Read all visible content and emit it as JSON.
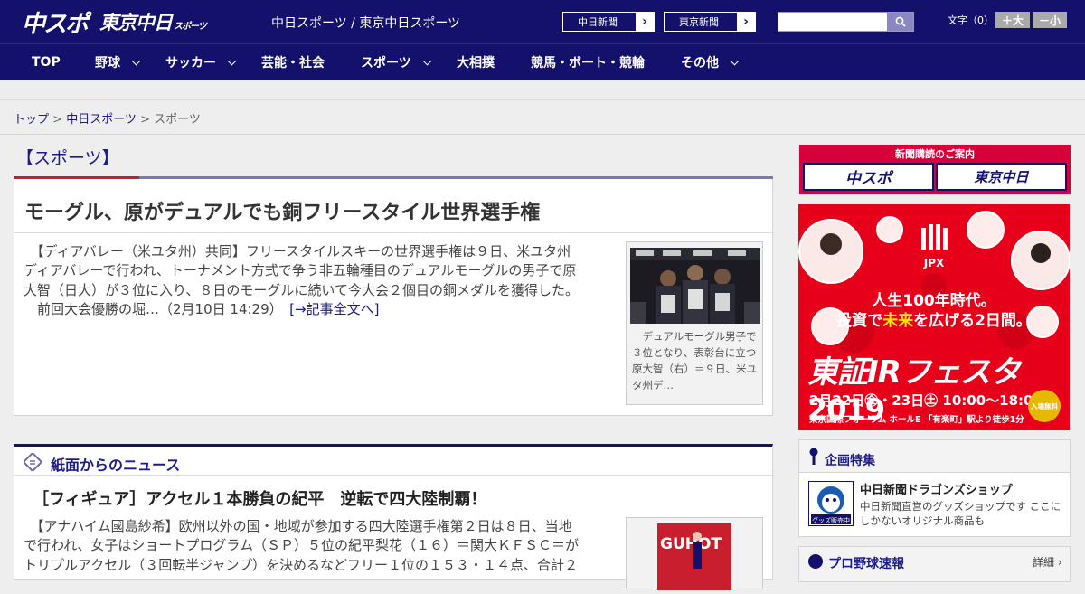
{
  "header": {
    "logo_main": "中スポ",
    "logo_tokyo": "東京中日",
    "logo_tokyo_sub": "スポーツ",
    "site_links": "中日スポーツ / 東京中日スポーツ",
    "chunichi_btn": "中日新聞",
    "tokyo_btn": "東京新聞",
    "search_placeholder": "",
    "font_size_label": "文字（0）",
    "font_up": "＋大",
    "font_down": "－小"
  },
  "nav": {
    "items": [
      {
        "label": "TOP"
      },
      {
        "label": "野球"
      },
      {
        "label": "サッカー"
      },
      {
        "label": "芸能・社会"
      },
      {
        "label": "スポーツ"
      },
      {
        "label": "大相撲"
      },
      {
        "label": "競馬・ボート・競輪"
      },
      {
        "label": "その他"
      }
    ]
  },
  "breadcrumb": {
    "top": "トップ",
    "sep": " > ",
    "chunichi": "中日スポーツ",
    "current": "スポーツ"
  },
  "section_title": "【スポーツ】",
  "article": {
    "headline": "モーグル、原がデュアルでも銅フリースタイル世界選手権",
    "lines": [
      "　【ディアバレー（米ユタ州）共同】フリースタイルスキーの世界選手権は９日、米ユタ州",
      "ディアバレーで行われ、トーナメント方式で争う非五輪種目のデュアルモーグルの男子で原",
      "大智（日大）が３位に入り、８日のモーグルに続いて今大会２個目の銅メダルを獲得した。",
      "　前回大会優勝の堀…（2月10日 14:29）"
    ],
    "more": "[→記事全文へ]",
    "caption": "デュアルモーグル男子で３位となり、表彰台に立つ原大智（右）＝９日、米ユタ州デ…"
  },
  "news": {
    "section_title": "紙面からのニュース",
    "headline": "［フィギュア］アクセル１本勝負の紀平　逆転で四大陸制覇！",
    "lines": [
      "　【アナハイム國島紗希】欧州以外の国・地域が参加する四大陸選手権第２日は８日、当地",
      "で行われ、女子はショートプログラム（ＳＰ）５位の紀平梨花（１６）＝関大ＫＦＳＣ＝が",
      "トリプルアクセル（３回転半ジャンプ）を決めるなどフリー１位の１５３・１４点、合計２"
    ],
    "photo_text": "GUHOT"
  },
  "sidebar": {
    "subscribe_title": "新聞購読のご案内",
    "sub_logo1": "中スポ",
    "sub_logo2": "東京中日",
    "ad": {
      "jpx": "JPX",
      "line1": "人生100年時代。",
      "line2_a": "投資で",
      "line2_b": "未来",
      "line2_c": "を広げる2日間。",
      "title": "東証IRフェスタ",
      "year": "2019",
      "date": "2月22日㊎・23日㊏ 10:00～18:00",
      "place": "東京国際フォーラム ホールE 「有楽町」駅より徒歩1分",
      "free": "入場無料"
    },
    "kikaku_title": "企画特集",
    "shop_title": "中日新聞ドラゴンズショップ",
    "shop_desc": "中日新聞直営のグッズショップです ここにしかないオリジナル商品も",
    "shop_badge": "グッズ販売中",
    "baseball_title": "プロ野球速報",
    "baseball_detail": "詳細 ›"
  },
  "colors": {
    "brand_navy": "#13116b",
    "link_blue": "#1b1a8f",
    "accent_red": "#cc1a2b",
    "ad_red": "#e60019"
  }
}
